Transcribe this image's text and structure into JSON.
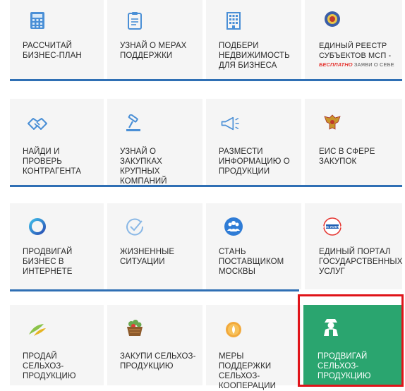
{
  "tiles": {
    "r1c1": {
      "label": "РАССЧИТАЙ БИЗНЕС-ПЛАН",
      "icon": "calculator-icon"
    },
    "r1c2": {
      "label": "УЗНАЙ О МЕРАХ ПОДДЕРЖКИ",
      "icon": "clipboard-icon"
    },
    "r1c3": {
      "label": "ПОДБЕРИ НЕДВИЖИМОСТЬ ДЛЯ БИЗНЕСА",
      "icon": "building-icon"
    },
    "r1c4": {
      "label": "ЕДИНЫЙ РЕЕСТР СУБЪЕКТОВ МСП -",
      "sub_highlight": "БЕСПЛАТНО",
      "sub_rest": " ЗАЯВИ О СЕБЕ",
      "icon": "emblem-icon"
    },
    "r2c1": {
      "label": "НАЙДИ И ПРОВЕРЬ КОНТРАГЕНТА",
      "icon": "handshake-icon"
    },
    "r2c2": {
      "label": "УЗНАЙ О ЗАКУПКАХ КРУПНЫХ КОМПАНИЙ",
      "icon": "gavel-icon"
    },
    "r2c3": {
      "label": "РАЗМЕСТИ ИНФОРМАЦИЮ О ПРОДУКЦИИ",
      "icon": "megaphone-icon"
    },
    "r2c4": {
      "label": "ЕИС В СФЕРЕ ЗАКУПОК",
      "icon": "eagle-icon"
    },
    "r3c1": {
      "label": "ПРОДВИГАЙ БИЗНЕС В ИНТЕРНЕТЕ",
      "icon": "ring-icon"
    },
    "r3c2": {
      "label": "ЖИЗНЕННЫЕ СИТУАЦИИ",
      "icon": "check-circle-icon"
    },
    "r3c3": {
      "label": "СТАНЬ ПОСТАВЩИКОМ МОСКВЫ",
      "icon": "people-icon"
    },
    "r3c4": {
      "label": "ЕДИНЫЙ ПОРТАЛ ГОСУДАРСТВЕННЫХ УСЛУГ",
      "icon": "gosuslugi-icon",
      "icon_text": "ГОС УСЛУГИ"
    },
    "r4c1": {
      "label": "ПРОДАЙ СЕЛЬХОЗ-ПРОДУКЦИЮ",
      "icon": "sprout-icon"
    },
    "r4c2": {
      "label": "ЗАКУПИ СЕЛЬХОЗ-ПРОДУКЦИЮ",
      "icon": "basket-icon"
    },
    "r4c3": {
      "label": "МЕРЫ ПОДДЕРЖКИ СЕЛЬХОЗ-КООПЕРАЦИИ",
      "icon": "coin-icon"
    },
    "r4c4": {
      "label": "ПРОДВИГАЙ СЕЛЬХОЗ-ПРОДУКЦИЮ",
      "icon": "farmer-icon"
    }
  },
  "colors": {
    "accent_line": "#2f6fb4",
    "tile_bg": "#f5f5f5",
    "active_tile": "#2aa56f",
    "highlight_border": "#e0141a"
  }
}
